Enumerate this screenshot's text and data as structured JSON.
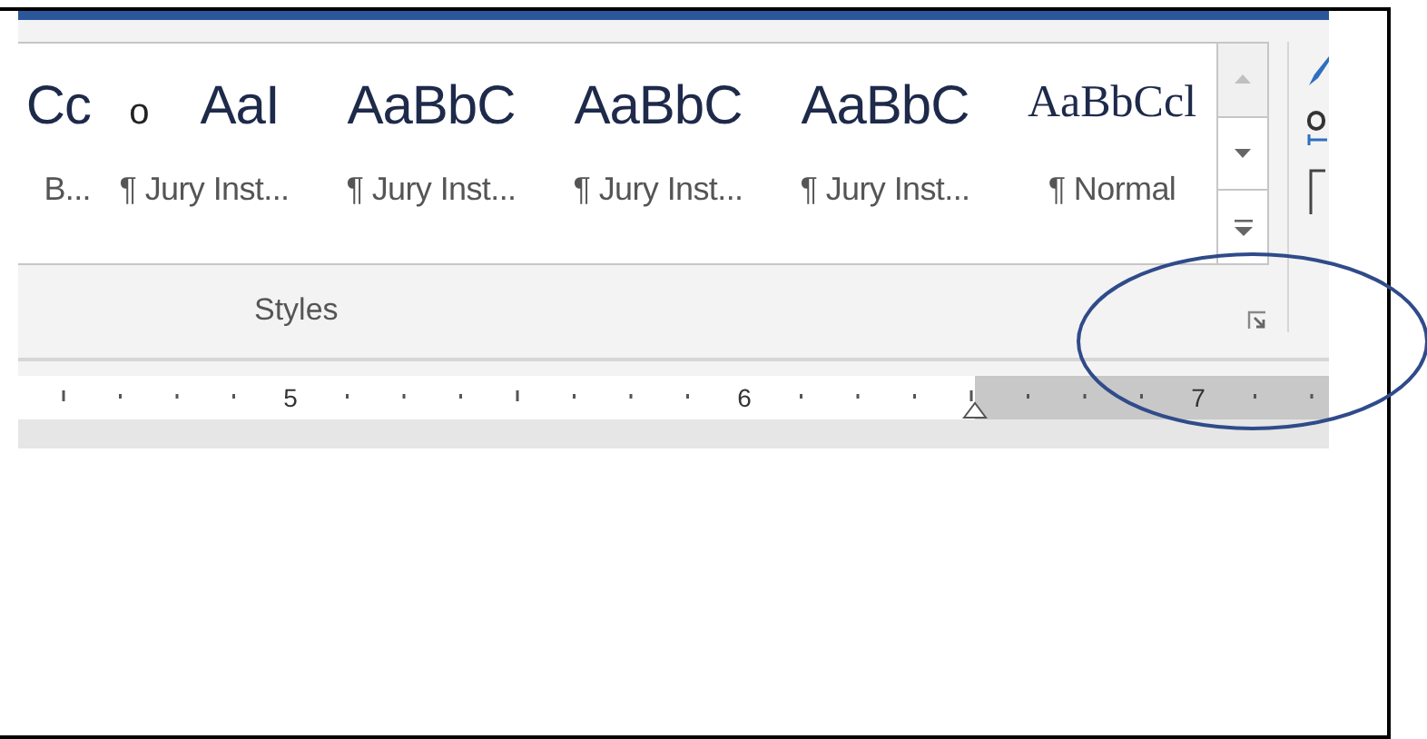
{
  "styles_gallery": {
    "items": [
      {
        "preview": "Cc",
        "label": "B..."
      },
      {
        "bullet": "o",
        "preview": "AaI",
        "label": "¶ Jury Inst..."
      },
      {
        "preview": "AaBbC",
        "label": "¶ Jury Inst..."
      },
      {
        "preview": "AaBbC",
        "label": "¶ Jury Inst..."
      },
      {
        "preview": "AaBbC",
        "label": "¶ Jury Inst..."
      },
      {
        "preview": "AaBbCcl",
        "label": "¶ Normal",
        "serif": true
      }
    ]
  },
  "group_label": "Styles",
  "ruler": {
    "numbers": [
      "5",
      "6",
      "7"
    ]
  },
  "annotation": {
    "kind": "ellipse"
  }
}
